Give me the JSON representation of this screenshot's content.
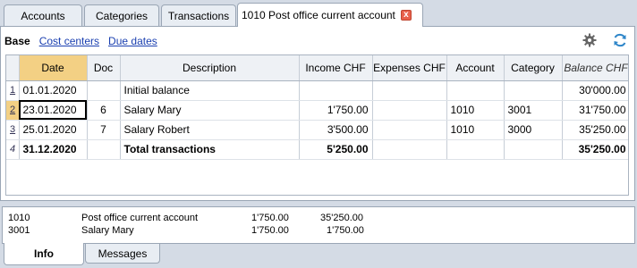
{
  "tabs": [
    {
      "label": "Accounts"
    },
    {
      "label": "Categories"
    },
    {
      "label": "Transactions"
    },
    {
      "label": "1010 Post office current account",
      "close": "x"
    }
  ],
  "subtabs": [
    {
      "label": "Base"
    },
    {
      "label": "Cost centers"
    },
    {
      "label": "Due dates"
    }
  ],
  "columns": [
    "",
    "Date",
    "Doc",
    "Description",
    "Income CHF",
    "Expenses CHF",
    "Account",
    "Category",
    "Balance CHF"
  ],
  "rows": [
    {
      "n": "1",
      "date": "01.01.2020",
      "doc": "",
      "desc": "Initial balance",
      "income": "",
      "expenses": "",
      "account": "",
      "category": "",
      "balance": "30'000.00"
    },
    {
      "n": "2",
      "date": "23.01.2020",
      "doc": "6",
      "desc": "Salary Mary",
      "income": "1'750.00",
      "expenses": "",
      "account": "1010",
      "category": "3001",
      "balance": "31'750.00"
    },
    {
      "n": "3",
      "date": "25.01.2020",
      "doc": "7",
      "desc": "Salary Robert",
      "income": "3'500.00",
      "expenses": "",
      "account": "1010",
      "category": "3000",
      "balance": "35'250.00"
    },
    {
      "n": "4",
      "date": "31.12.2020",
      "doc": "",
      "desc": "Total transactions",
      "income": "5'250.00",
      "expenses": "",
      "account": "",
      "category": "",
      "balance": "35'250.00"
    }
  ],
  "info": [
    {
      "code": "1010",
      "name": "Post office current account",
      "amount": "1'750.00",
      "balance": "35'250.00"
    },
    {
      "code": "3001",
      "name": "Salary Mary",
      "amount": "1'750.00",
      "balance": "1'750.00"
    }
  ],
  "bottom_tabs": [
    {
      "label": "Info"
    },
    {
      "label": "Messages"
    }
  ],
  "icons": {
    "settings": "gear-icon",
    "refresh": "refresh-icon"
  },
  "colors": {
    "accent": "#f3d084",
    "link": "#1a3fb0",
    "refresh": "#2e86c9",
    "close": "#e8604c"
  }
}
